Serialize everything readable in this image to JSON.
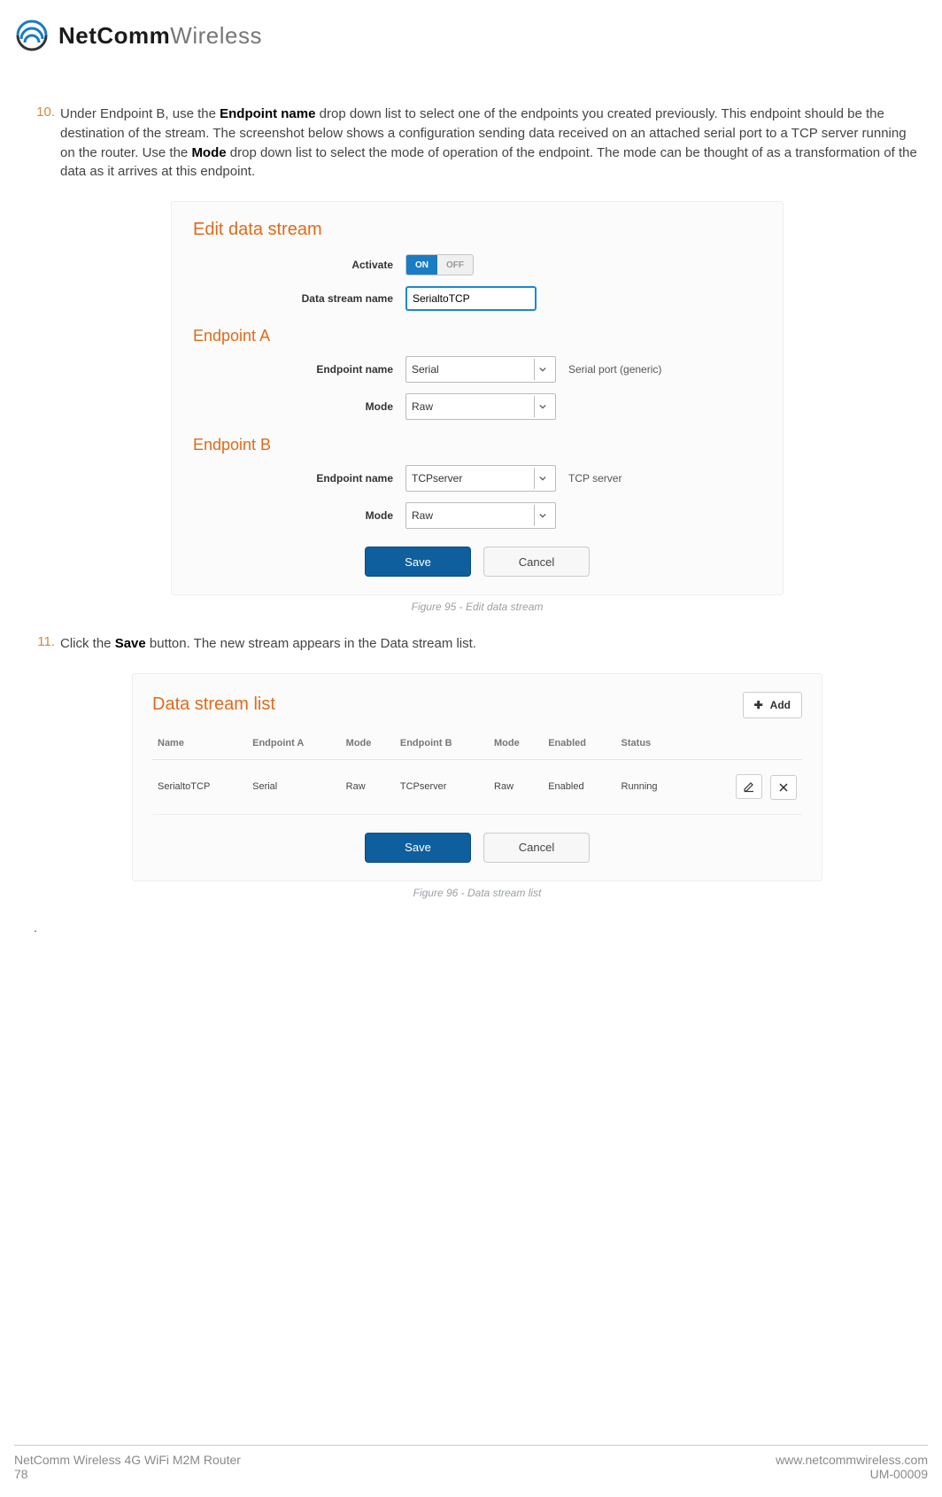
{
  "logo": {
    "bold": "NetComm",
    "light": "Wireless"
  },
  "step10": {
    "num": "10.",
    "pre": "Under Endpoint B, use the ",
    "b1": "Endpoint name",
    "mid1": " drop down list to select one of the endpoints you created previously. This endpoint should be the destination of the stream. The screenshot below shows a configuration sending data received on an attached serial port to a TCP server running on the router. Use the ",
    "b2": "Mode",
    "mid2": " drop down list to select the mode of operation of the endpoint. The mode can be thought of as a transformation of the data as it arrives at this endpoint."
  },
  "panel1": {
    "title": "Edit data stream",
    "activate_label": "Activate",
    "toggle_on": "ON",
    "toggle_off": "OFF",
    "name_label": "Data stream name",
    "name_value": "SerialtoTCP",
    "epA_title": "Endpoint A",
    "epB_title": "Endpoint B",
    "ep_name_label": "Endpoint name",
    "mode_label": "Mode",
    "epA_name": "Serial",
    "epA_hint": "Serial port (generic)",
    "epA_mode": "Raw",
    "epB_name": "TCPserver",
    "epB_hint": "TCP server",
    "epB_mode": "Raw",
    "save": "Save",
    "cancel": "Cancel"
  },
  "caption1": "Figure 95 - Edit data stream",
  "step11": {
    "num": "11.",
    "pre": "Click the ",
    "b1": "Save",
    "post": " button. The new stream appears in the Data stream list."
  },
  "panel2": {
    "title": "Data stream list",
    "add": "Add",
    "cols": {
      "name": "Name",
      "epA": "Endpoint A",
      "modeA": "Mode",
      "epB": "Endpoint B",
      "modeB": "Mode",
      "enabled": "Enabled",
      "status": "Status"
    },
    "row": {
      "name": "SerialtoTCP",
      "epA": "Serial",
      "modeA": "Raw",
      "epB": "TCPserver",
      "modeB": "Raw",
      "enabled": "Enabled",
      "status": "Running"
    },
    "save": "Save",
    "cancel": "Cancel"
  },
  "caption2": "Figure 96 - Data stream list",
  "footer": {
    "product": "NetComm Wireless 4G WiFi M2M Router",
    "page": "78",
    "site": "www.netcommwireless.com",
    "doc": "UM-00009"
  }
}
